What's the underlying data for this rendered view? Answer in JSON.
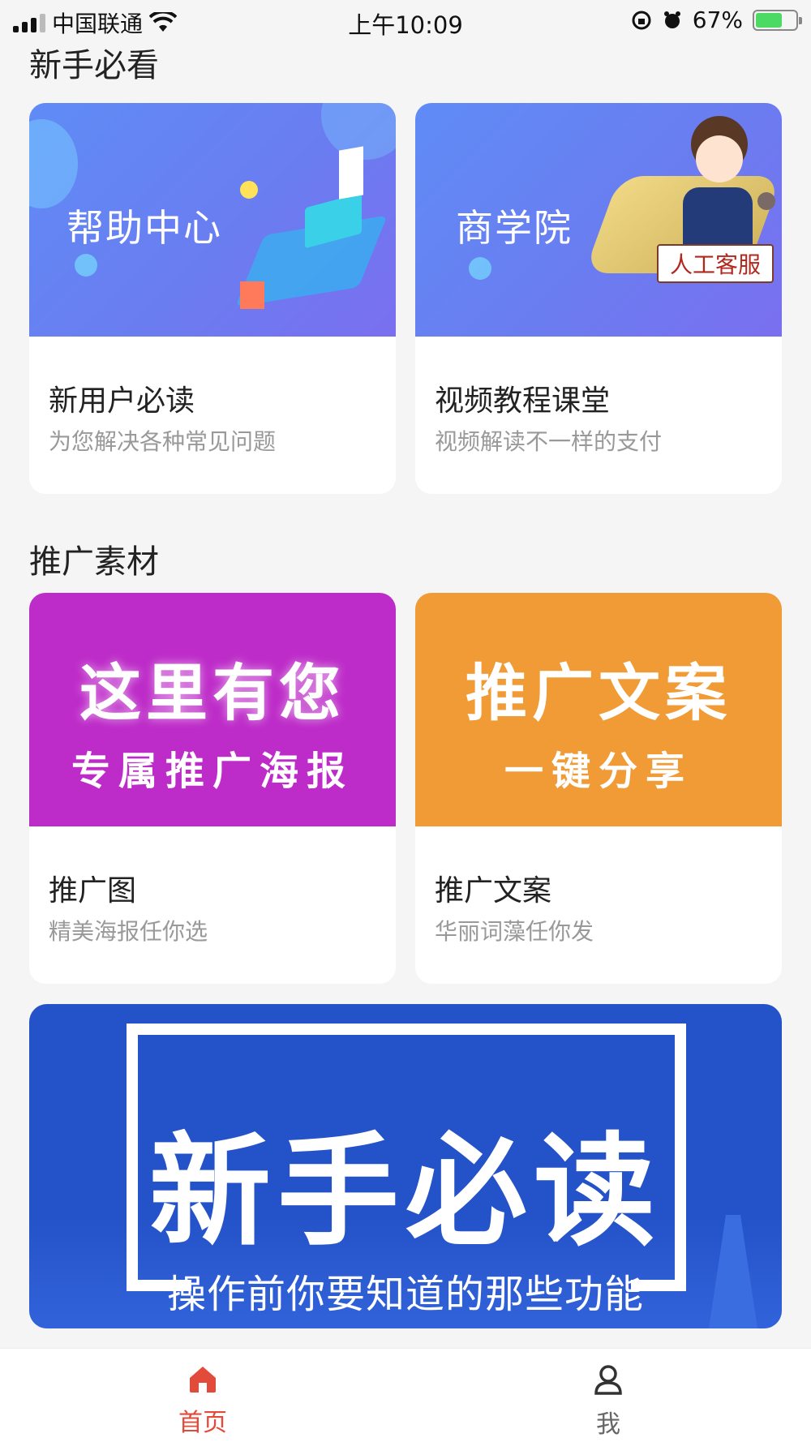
{
  "status_bar": {
    "carrier": "中国联通",
    "time": "上午10:09",
    "battery_percent": "67%"
  },
  "sections": {
    "beginner": {
      "title": "新手必看"
    },
    "promo": {
      "title": "推广素材"
    }
  },
  "cards": {
    "help": {
      "banner_text": "帮助中心",
      "title": "新用户必读",
      "subtitle": "为您解决各种常见问题"
    },
    "academy": {
      "banner_text": "商学院",
      "badge": "人工客服",
      "title": "视频教程课堂",
      "subtitle": "视频解读不一样的支付"
    },
    "poster": {
      "banner_line1": "这里有您",
      "banner_line2": "专属推广海报",
      "title": "推广图",
      "subtitle": "精美海报任你选"
    },
    "copywriting": {
      "banner_line1": "推广文案",
      "banner_line2": "一键分享",
      "title": "推广文案",
      "subtitle": "华丽词藻任你发"
    }
  },
  "wide_banner": {
    "title": "新手必读",
    "subtitle": "操作前你要知道的那些功能"
  },
  "tab_bar": {
    "home": "首页",
    "me": "我",
    "active_color": "#e24a3a"
  }
}
